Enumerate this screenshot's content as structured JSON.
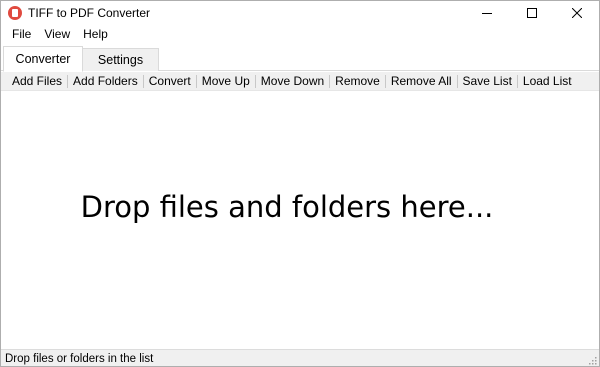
{
  "window": {
    "title": "TIFF to PDF Converter",
    "icon": "app-pdf-icon"
  },
  "menu": [
    {
      "label": "File"
    },
    {
      "label": "View"
    },
    {
      "label": "Help"
    }
  ],
  "tabs": [
    {
      "label": "Converter",
      "active": true
    },
    {
      "label": "Settings",
      "active": false
    }
  ],
  "toolbar": {
    "add_files": "Add Files",
    "add_folders": "Add Folders",
    "convert": "Convert",
    "move_up": "Move Up",
    "move_down": "Move Down",
    "remove": "Remove",
    "remove_all": "Remove All",
    "save_list": "Save List",
    "load_list": "Load List"
  },
  "drop_area": {
    "text": "Drop files and folders here..."
  },
  "status": {
    "text": "Drop files or folders in the list"
  },
  "colors": {
    "accent": "#e04a3f",
    "toolbar_bg": "#f0f0f0"
  }
}
